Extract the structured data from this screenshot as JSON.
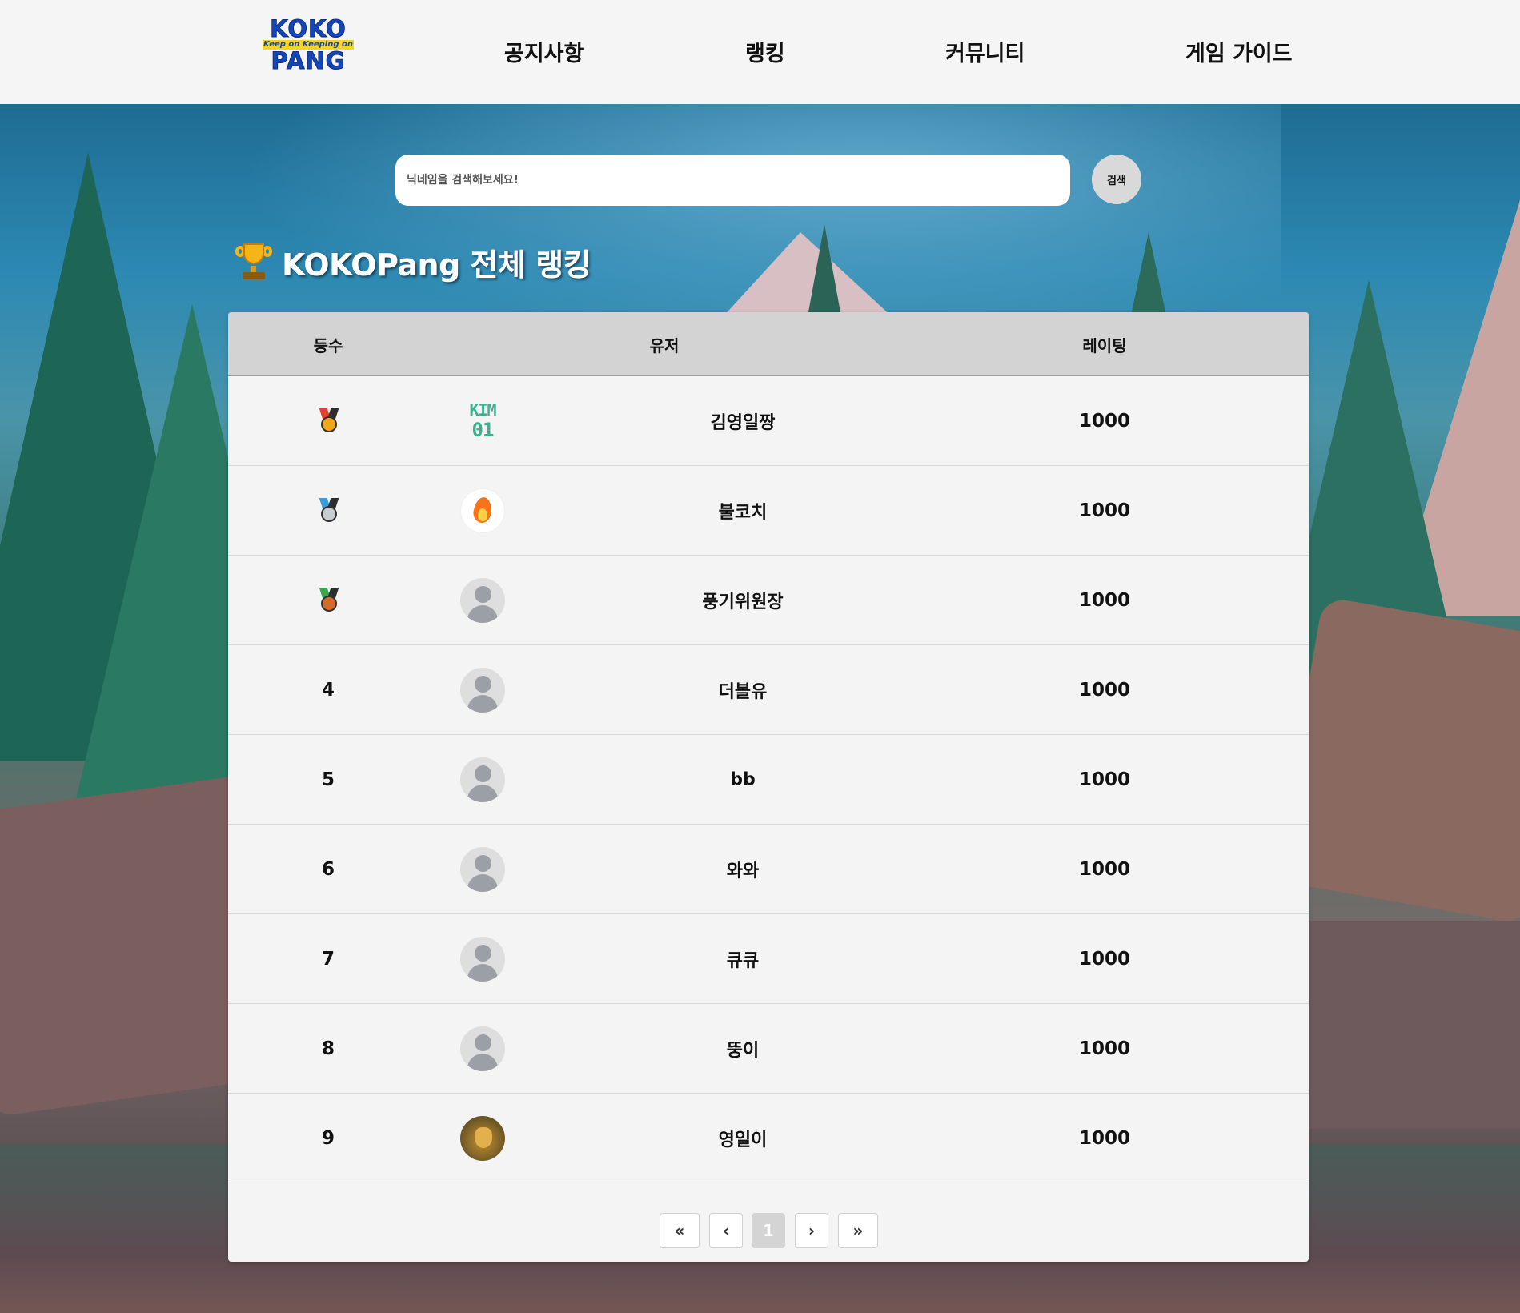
{
  "logo": {
    "line1": "KOKO",
    "line2": "Keep on Keeping on",
    "line3": "PANG"
  },
  "nav": [
    "공지사항",
    "랭킹",
    "커뮤니티",
    "게임 가이드"
  ],
  "search": {
    "placeholder": "닉네임을 검색해보세요!",
    "button_label": "검색"
  },
  "title": "KOKOPang 전체 랭킹",
  "table": {
    "headers": {
      "rank": "등수",
      "user": "유저",
      "rating": "레이팅"
    },
    "rows": [
      {
        "rank": "1",
        "medal": "gold-medal-icon",
        "avatar": "kim01-avatar",
        "nickname": "김영일짱",
        "rating": "1000"
      },
      {
        "rank": "2",
        "medal": "silver-medal-icon",
        "avatar": "fire-avatar",
        "nickname": "불코치",
        "rating": "1000"
      },
      {
        "rank": "3",
        "medal": "bronze-medal-icon",
        "avatar": "default-avatar",
        "nickname": "풍기위원장",
        "rating": "1000"
      },
      {
        "rank": "4",
        "avatar": "default-avatar",
        "nickname": "더블유",
        "rating": "1000"
      },
      {
        "rank": "5",
        "avatar": "default-avatar",
        "nickname": "bb",
        "rating": "1000"
      },
      {
        "rank": "6",
        "avatar": "default-avatar",
        "nickname": "와와",
        "rating": "1000"
      },
      {
        "rank": "7",
        "avatar": "default-avatar",
        "nickname": "큐큐",
        "rating": "1000"
      },
      {
        "rank": "8",
        "avatar": "default-avatar",
        "nickname": "뚱이",
        "rating": "1000"
      },
      {
        "rank": "9",
        "avatar": "photo-avatar",
        "nickname": "영일이",
        "rating": "1000"
      }
    ]
  },
  "pagination": {
    "first": "«",
    "prev": "‹",
    "current": "1",
    "next": "›",
    "last": "»"
  },
  "colors": {
    "header_bg": "#f5f5f5",
    "panel_bg": "#f4f4f4",
    "table_head_bg": "#d3d3d3",
    "logo_blue": "#1546b8",
    "logo_yellow": "#f5d423"
  }
}
